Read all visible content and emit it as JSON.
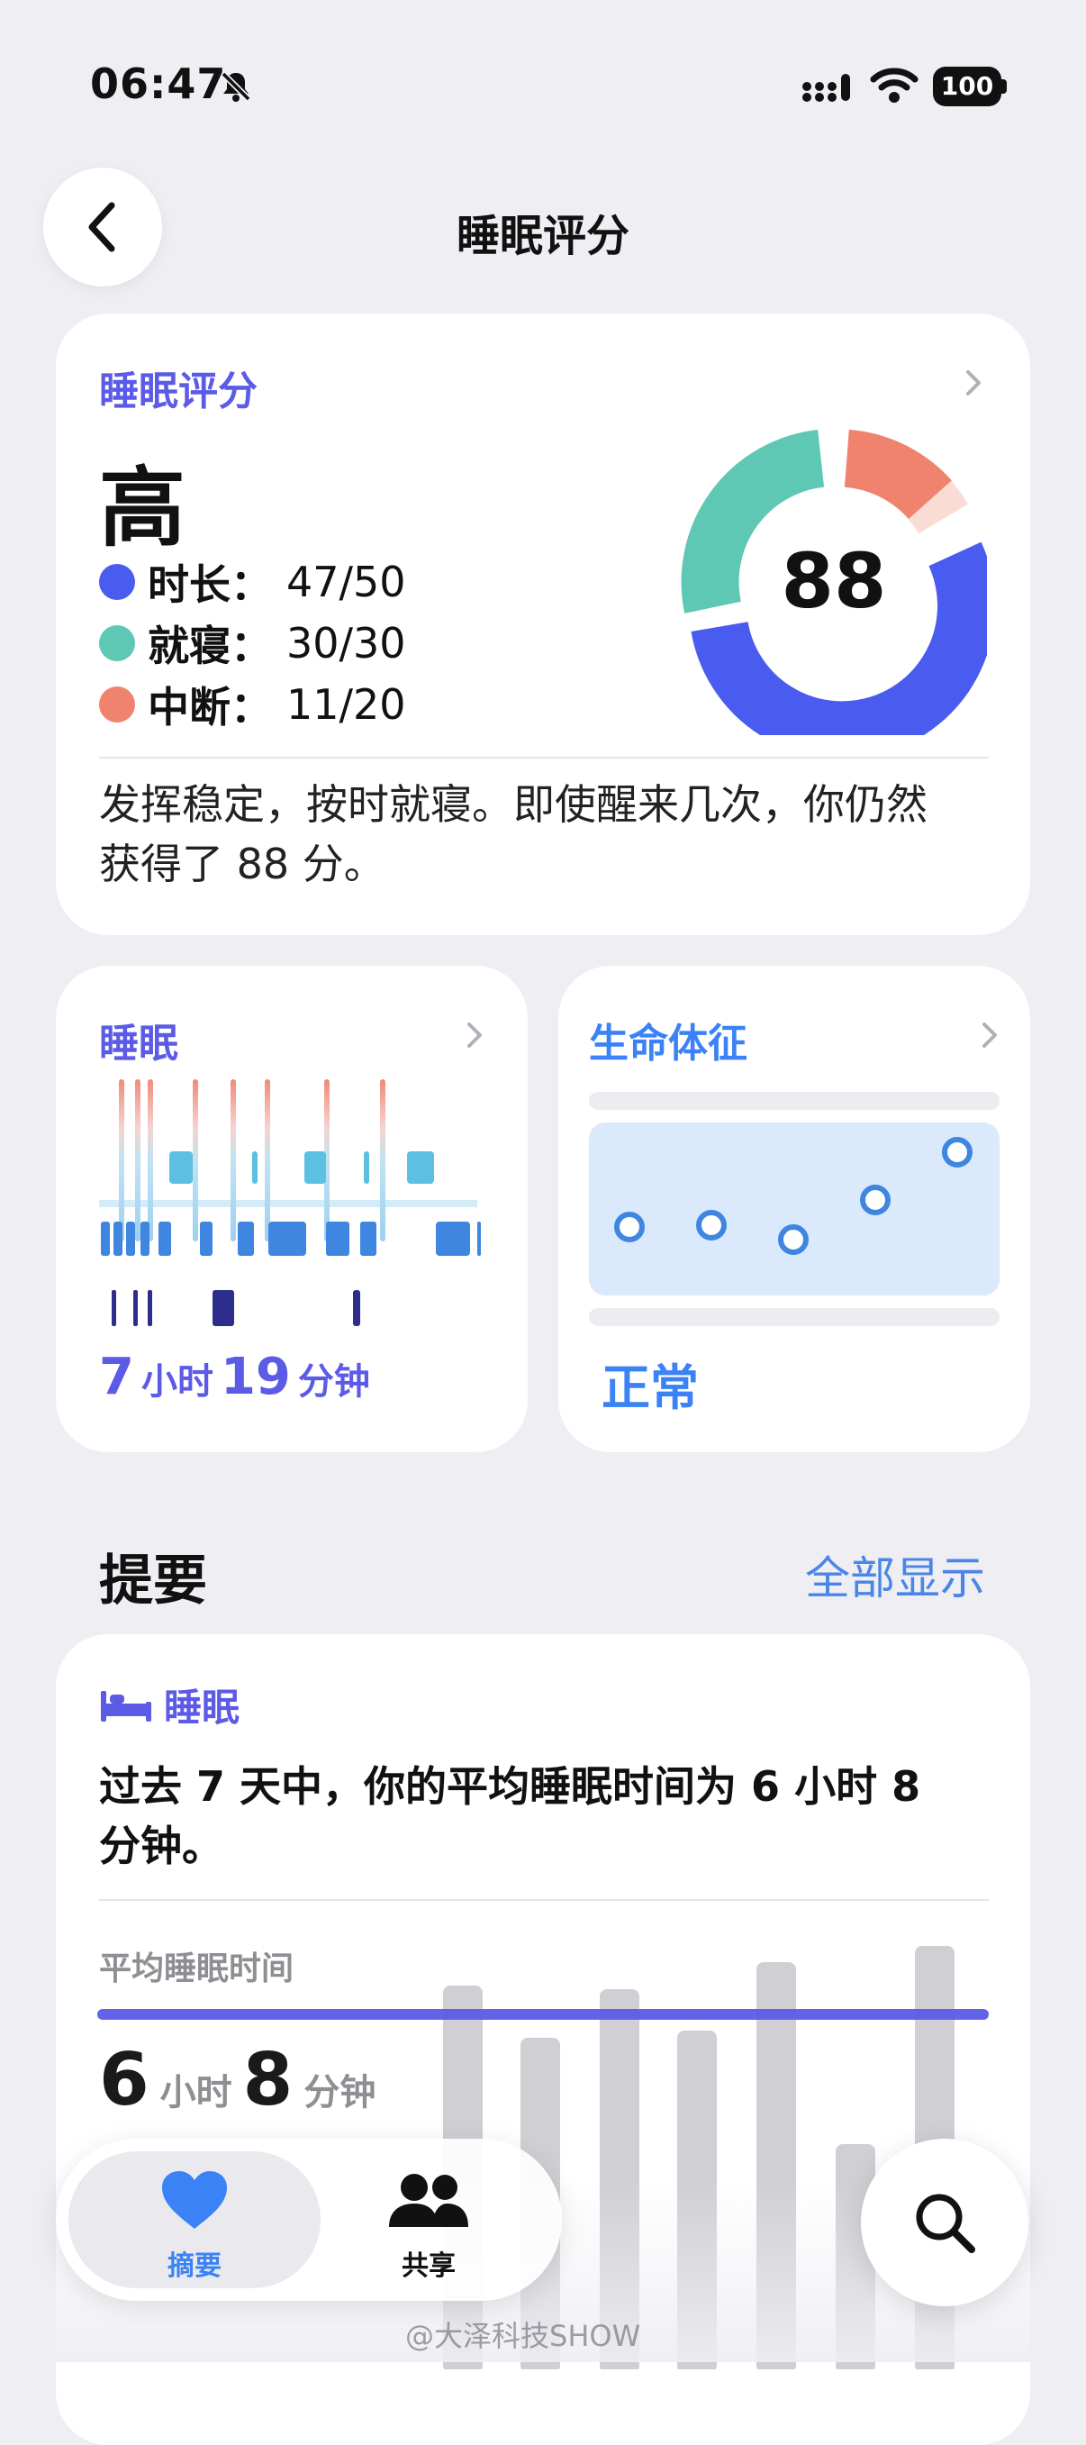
{
  "status": {
    "time": "06:47",
    "battery": "100"
  },
  "header": {
    "title": "睡眠评分"
  },
  "score_card": {
    "label": "睡眠评分",
    "level": "高",
    "score": "88",
    "metrics": [
      {
        "key": "时长：",
        "value": "47/50",
        "color": "#4a5cf0"
      },
      {
        "key": "就寝：",
        "value": "30/30",
        "color": "#5ec8b4"
      },
      {
        "key": "中断：",
        "value": "11/20",
        "color": "#f0836e"
      }
    ],
    "summary": "发挥稳定，按时就寝。即使醒来几次，你仍然获得了 88 分。"
  },
  "sleep_card": {
    "label": "睡眠",
    "hours": "7",
    "hours_unit": "小时",
    "minutes": "19",
    "minutes_unit": "分钟"
  },
  "vitals_card": {
    "label": "生命体征",
    "status": "正常"
  },
  "highlights": {
    "title": "提要",
    "show_all": "全部显示",
    "tag": "睡眠",
    "summary": "过去 7 天中，你的平均睡眠时间为 6 小时 8 分钟。",
    "avg_label": "平均睡眠时间",
    "avg_hours": "6",
    "avg_hours_unit": "小时",
    "avg_minutes": "8",
    "avg_minutes_unit": "分钟"
  },
  "tabs": [
    {
      "label": "摘要",
      "icon": "heart-icon",
      "active": true
    },
    {
      "label": "共享",
      "icon": "people-icon",
      "active": false
    }
  ],
  "watermark": "@大泽科技SHOW",
  "colors": {
    "accent": "#5b5be6",
    "blue": "#4a86e8",
    "duration": "#4a5cf0",
    "bedtime": "#5ec8b4",
    "interrupt": "#f0836e"
  }
}
